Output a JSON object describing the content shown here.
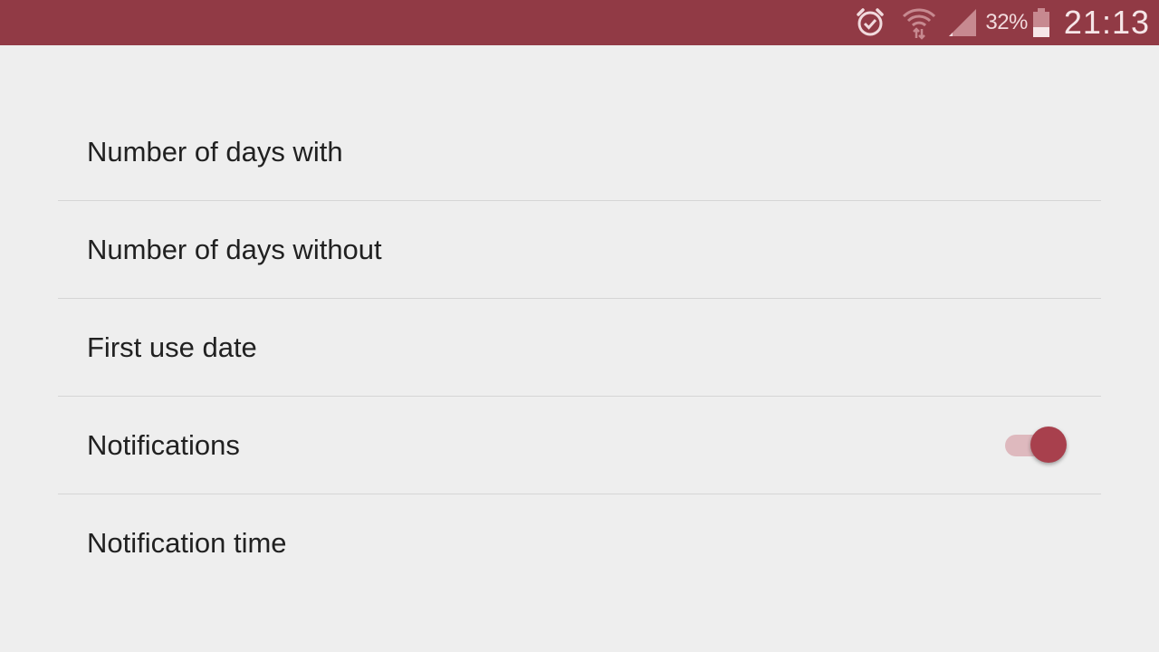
{
  "status_bar": {
    "battery_percent": "32%",
    "time": "21:13",
    "background_color": "#913a45",
    "icons": [
      "alarm-icon",
      "wifi-icon",
      "signal-icon",
      "battery-icon"
    ]
  },
  "settings": {
    "items": [
      {
        "label": "Number of days with"
      },
      {
        "label": "Number of days without"
      },
      {
        "label": "First use date"
      },
      {
        "label": "Notifications",
        "toggle_on": true
      },
      {
        "label": "Notification time"
      }
    ]
  },
  "colors": {
    "accent": "#a8404d",
    "toggle_track": "#deb9be",
    "background": "#eeeeee",
    "text": "#212121"
  }
}
